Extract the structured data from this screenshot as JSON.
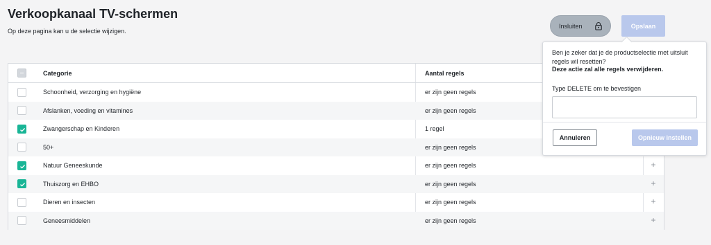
{
  "header": {
    "title": "Verkoopkanaal TV-schermen",
    "subtitle": "Op deze pagina kan u de selectie wijzigen.",
    "lock_button_label": "Insluiten",
    "save_button_label": "Opslaan"
  },
  "table": {
    "columns": [
      "Categorie",
      "Aantal regels"
    ],
    "rows": [
      {
        "category": "Schoonheid, verzorging en hygiëne",
        "rules": "er zijn geen regels",
        "checked": false
      },
      {
        "category": "Afslanken, voeding en vitamines",
        "rules": "er zijn geen regels",
        "checked": false
      },
      {
        "category": "Zwangerschap en Kinderen",
        "rules": "1 regel",
        "checked": true
      },
      {
        "category": "50+",
        "rules": "er zijn geen regels",
        "checked": false
      },
      {
        "category": "Natuur Geneeskunde",
        "rules": "er zijn geen regels",
        "checked": true
      },
      {
        "category": "Thuiszorg en EHBO",
        "rules": "er zijn geen regels",
        "checked": true
      },
      {
        "category": "Dieren en insecten",
        "rules": "er zijn geen regels",
        "checked": false
      },
      {
        "category": "Geneesmiddelen",
        "rules": "er zijn geen regels",
        "checked": false
      }
    ],
    "add_glyph": "+"
  },
  "popover": {
    "message": "Ben je zeker dat je de productselectie met uitsluit regels wil resetten?",
    "warning": "Deze actie zal alle regels verwijderen.",
    "input_label": "Type DELETE om te bevestigen",
    "input_value": "",
    "cancel_label": "Annuleren",
    "confirm_label": "Opnieuw instellen"
  },
  "colors": {
    "accent_teal": "#19b596",
    "disabled_blue": "#b9c8ec",
    "lock_button_gray": "#a9b2bb"
  },
  "icons": {
    "lock": "lock-icon",
    "check": "check-icon",
    "plus": "plus-icon"
  }
}
